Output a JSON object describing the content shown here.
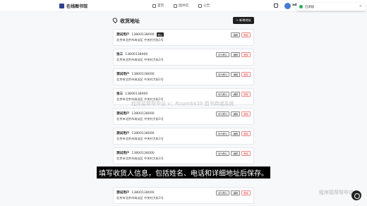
{
  "header": {
    "brand": "在线图书馆",
    "nav": [
      {
        "label": "首页",
        "icon": "home-icon"
      },
      {
        "label": "图书馆",
        "icon": "book-icon"
      },
      {
        "label": "公告",
        "icon": "megaphone-icon"
      }
    ],
    "cart_icon": "cart-icon",
    "user_name": "adr"
  },
  "toast": {
    "text": "已添加",
    "icon": "check-circle-icon",
    "close": "×"
  },
  "page": {
    "title": "收货地址",
    "add_button": "+ 新增地址"
  },
  "addresses": [
    {
      "name": "测试用户",
      "phone": "13800138000",
      "address": "北京市北京市海淀区 中关村大街1号",
      "badge": "默认",
      "set_default": "",
      "edit": "编辑",
      "delete": "删除"
    },
    {
      "name": "张三",
      "phone": "13800138000",
      "address": "北京市北京市海淀区 中关村大街1号",
      "badge": "",
      "set_default": "设为默认",
      "edit": "编辑",
      "delete": "删除"
    },
    {
      "name": "测试用户",
      "phone": "13800138000",
      "address": "北京市北京市海淀区 中关村大街1号",
      "badge": "",
      "set_default": "设为默认",
      "edit": "编辑",
      "delete": "删除"
    },
    {
      "name": "张三",
      "phone": "13800138000",
      "address": "北京市北京市海淀区 中关村大街1号",
      "badge": "",
      "set_default": "设为默认",
      "edit": "编辑",
      "delete": "删除"
    },
    {
      "name": "测试用户",
      "phone": "13800138000",
      "address": "北京市北京市海淀区 中关村大街1号",
      "badge": "",
      "set_default": "设为默认",
      "edit": "编辑",
      "delete": "删除"
    },
    {
      "name": "测试用户",
      "phone": "13800138000",
      "address": "北京市北京市海淀区 中关村大街1号",
      "badge": "",
      "set_default": "设为默认",
      "edit": "编辑",
      "delete": "删除"
    },
    {
      "name": "测试用户",
      "phone": "13800138000",
      "address": "北京市北京市海淀区 中关村大街1号",
      "badge": "",
      "set_default": "设为默认",
      "edit": "编辑",
      "delete": "删除"
    },
    {
      "name": "测试用户",
      "phone": "13800138000",
      "address": "北京市北京市海淀区 中关村大街1号",
      "badge": "",
      "set_default": "设为默认",
      "edit": "编辑",
      "delete": "删除"
    }
  ],
  "overlays": {
    "watermark": "程序猿帮帮毕设 v：Rosee6439 图书商城系统",
    "subtitle": "填写收货人信息，包括姓名、电话和详细地址后保存。",
    "corner_watermark": "程序猿帮帮毕设"
  },
  "colors": {
    "primary": "#1f1f1f",
    "success": "#27ae60",
    "danger": "#e04a4a"
  }
}
